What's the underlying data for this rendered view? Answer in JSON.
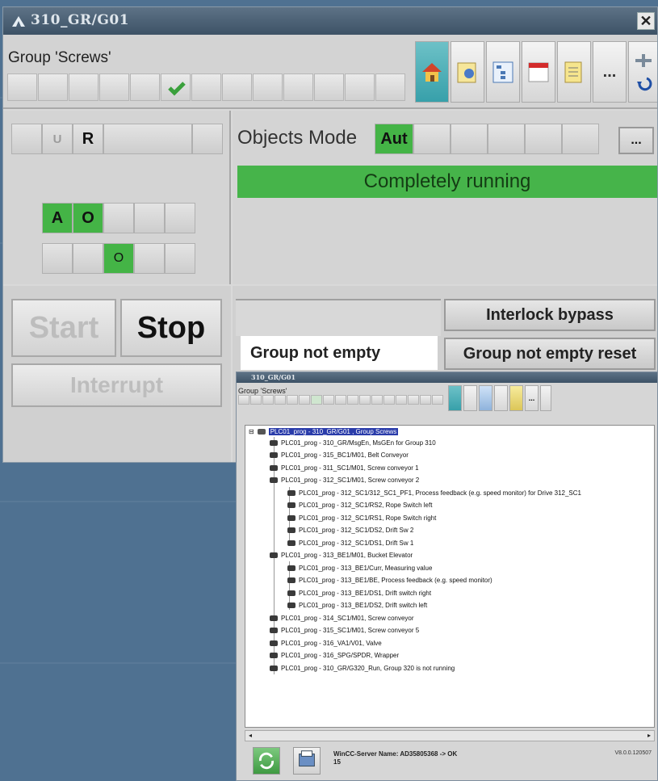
{
  "window": {
    "title": "310_GR/G01",
    "close_label": "✕",
    "group_name": "Group 'Screws'",
    "more_label": "..."
  },
  "icons": {
    "home": "home-icon",
    "trend": "trend-icon",
    "tree": "tree-icon",
    "calendar": "calendar-icon",
    "notes": "notes-icon",
    "more": "more-icon",
    "back": "back-icon"
  },
  "status_row": {
    "u": "U",
    "r": "R"
  },
  "ao_row": {
    "a": "A",
    "o": "O"
  },
  "o_row": {
    "o": "O"
  },
  "objects_mode": {
    "label": "Objects Mode",
    "mode": "Aut",
    "more_label": "...",
    "state": "Completely running"
  },
  "buttons": {
    "start": "Start",
    "stop": "Stop",
    "interrupt": "Interrupt",
    "interlock_bypass": "Interlock bypass",
    "group_not_empty": "Group not empty",
    "group_not_empty_reset": "Group not empty reset"
  },
  "tree_window": {
    "title": "310_GR/G01",
    "group_name": "Group 'Screws'",
    "root": "PLC01_prog - 310_GR/G01 , Group Screws",
    "items": [
      {
        "text": "PLC01_prog - 310_GR/MsgEn,  MsGEn for Group 310",
        "level": 1
      },
      {
        "text": "PLC01_prog - 315_BC1/M01,  Belt Conveyor",
        "level": 1
      },
      {
        "text": "PLC01_prog - 311_SC1/M01,  Screw conveyor 1",
        "level": 1
      },
      {
        "text": "PLC01_prog - 312_SC1/M01,  Screw conveyor 2",
        "level": 1
      },
      {
        "text": "PLC01_prog - 312_SC1/312_SC1_PF1,  Process feedback (e.g. speed monitor) for Drive 312_SC1",
        "level": 2
      },
      {
        "text": "PLC01_prog - 312_SC1/RS2,  Rope Switch left",
        "level": 2
      },
      {
        "text": "PLC01_prog - 312_SC1/RS1,  Rope Switch right",
        "level": 2
      },
      {
        "text": "PLC01_prog - 312_SC1/DS2,  Drift Sw 2",
        "level": 2
      },
      {
        "text": "PLC01_prog - 312_SC1/DS1,  Drift Sw 1",
        "level": 2
      },
      {
        "text": "PLC01_prog - 313_BE1/M01,  Bucket Elevator",
        "level": 1
      },
      {
        "text": "PLC01_prog - 313_BE1/Curr,  Measuring value",
        "level": 2
      },
      {
        "text": "PLC01_prog - 313_BE1/BE,  Process feedback (e.g. speed monitor)",
        "level": 2
      },
      {
        "text": "PLC01_prog - 313_BE1/DS1,  Drift switch right",
        "level": 2
      },
      {
        "text": "PLC01_prog - 313_BE1/DS2,  Drift switch left",
        "level": 2
      },
      {
        "text": "PLC01_prog - 314_SC1/M01,  Screw conveyor",
        "level": 1
      },
      {
        "text": "PLC01_prog - 315_SC1/M01,  Screw conveyor 5",
        "level": 1
      },
      {
        "text": "PLC01_prog - 316_VA1/V01,  Valve",
        "level": 1
      },
      {
        "text": "PLC01_prog - 316_SPG/SPDR,  Wrapper",
        "level": 1
      },
      {
        "text": "PLC01_prog - 310_GR/G320_Run,  Group 320 is not running",
        "level": 1
      }
    ],
    "server_label": "WinCC-Server Name: AD35805368  -> OK",
    "server_count": "15",
    "version": "V8.0.0.120507"
  },
  "colors": {
    "ok_green": "#46b44a",
    "title_blue": "#4a6076",
    "select_blue": "#2a3caa"
  }
}
